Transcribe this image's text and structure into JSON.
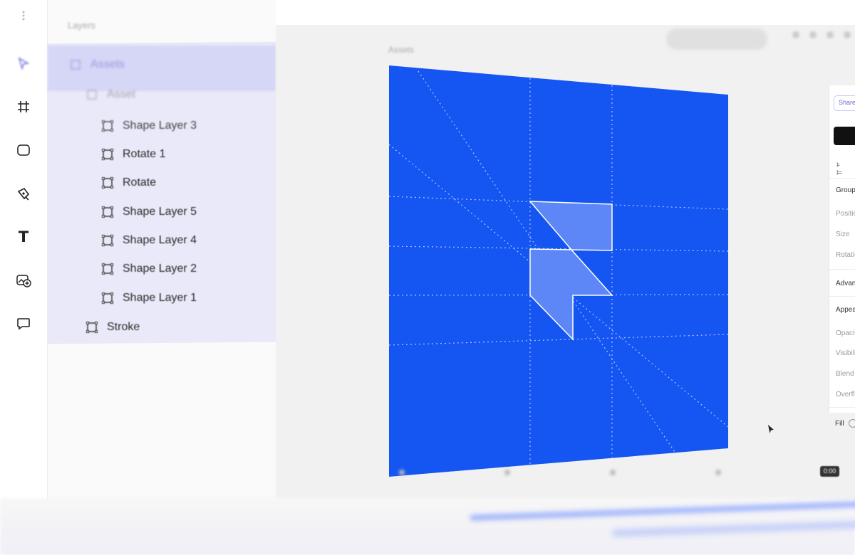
{
  "layers_panel": {
    "top_label": "Layers",
    "items": [
      {
        "name": "Assets"
      },
      {
        "name": "Asset"
      },
      {
        "name": "Shape Layer 3"
      },
      {
        "name": "Rotate 1"
      },
      {
        "name": "Rotate"
      },
      {
        "name": "Shape Layer 5"
      },
      {
        "name": "Shape Layer 4"
      },
      {
        "name": "Shape Layer 2"
      },
      {
        "name": "Shape Layer 1"
      },
      {
        "name": "Stroke"
      }
    ]
  },
  "canvas": {
    "frame_label": "Assets",
    "artboard_color": "#1555f2"
  },
  "tools": [
    "select-icon",
    "frame-icon",
    "rectangle-icon",
    "pen-icon",
    "text-icon",
    "add-image-icon",
    "comment-icon"
  ],
  "tool_text_glyph": "T",
  "properties": {
    "share_label": "Share",
    "align_glyphs": "⊧ ⊨",
    "group_label": "Group",
    "position_label": "Position",
    "size_label": "Size",
    "rotation_label": "Rotation",
    "advanced_label": "Advanced",
    "appearance_label": "Appearance",
    "opacity_label": "Opacity",
    "visibility_label": "Visibility",
    "blend_label": "Blend mode",
    "overflow_label": "Overflow",
    "fill_label": "Fill"
  },
  "timeline": {
    "time_tag": "0:00"
  }
}
